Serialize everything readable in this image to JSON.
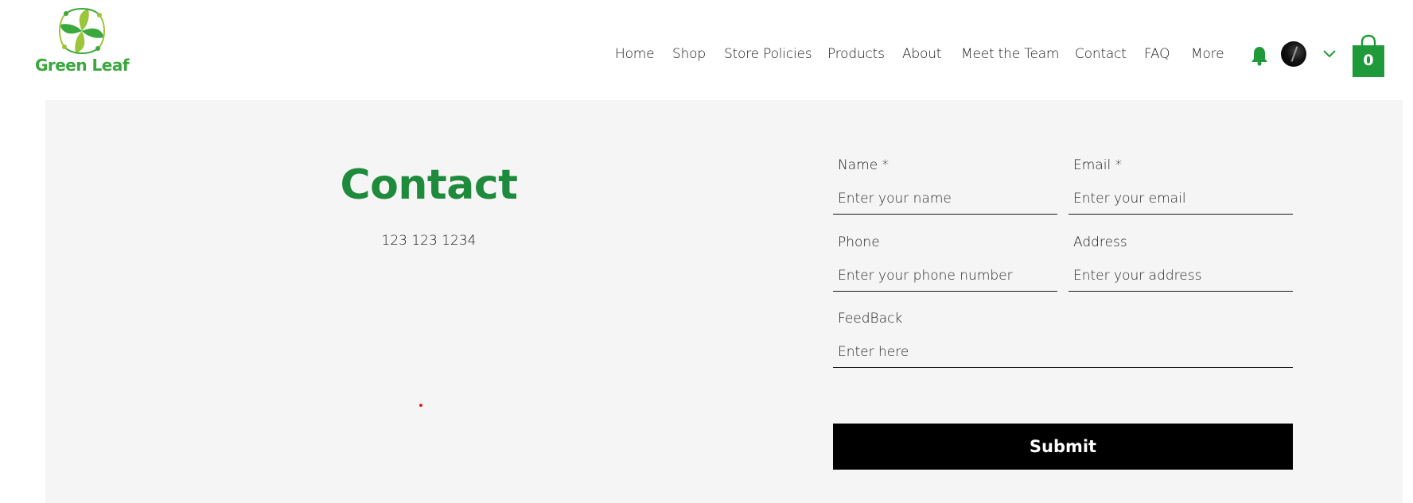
{
  "brand": {
    "name": "Green Leaf",
    "color": "#3aa83c"
  },
  "nav": {
    "items": [
      {
        "label": "Home"
      },
      {
        "label": "Shop"
      },
      {
        "label": "Store Policies"
      },
      {
        "label": "Products"
      },
      {
        "label": "About"
      },
      {
        "label": "Meet the Team"
      },
      {
        "label": "Contact"
      },
      {
        "label": "FAQ"
      },
      {
        "label": "More"
      }
    ]
  },
  "header_icons": {
    "notifications": "bell-icon",
    "avatar": "user-avatar",
    "menu_toggle": "chevron-down-icon",
    "cart": {
      "icon": "shopping-bag-icon",
      "count": "0"
    }
  },
  "colors": {
    "accent": "#1e8a3c",
    "icon_green": "#1f9a3a",
    "section_bg": "#f5f5f5",
    "button_bg": "#000000"
  },
  "contact": {
    "title": "Contact",
    "phone": "123 123 1234"
  },
  "form": {
    "name": {
      "label": "Name *",
      "placeholder": "Enter your name"
    },
    "email": {
      "label": "Email *",
      "placeholder": "Enter your email"
    },
    "phone": {
      "label": "Phone",
      "placeholder": "Enter your phone number"
    },
    "address": {
      "label": "Address",
      "placeholder": "Enter your address"
    },
    "feedback": {
      "label": "FeedBack",
      "placeholder": "Enter here"
    },
    "submit_label": "Submit"
  }
}
